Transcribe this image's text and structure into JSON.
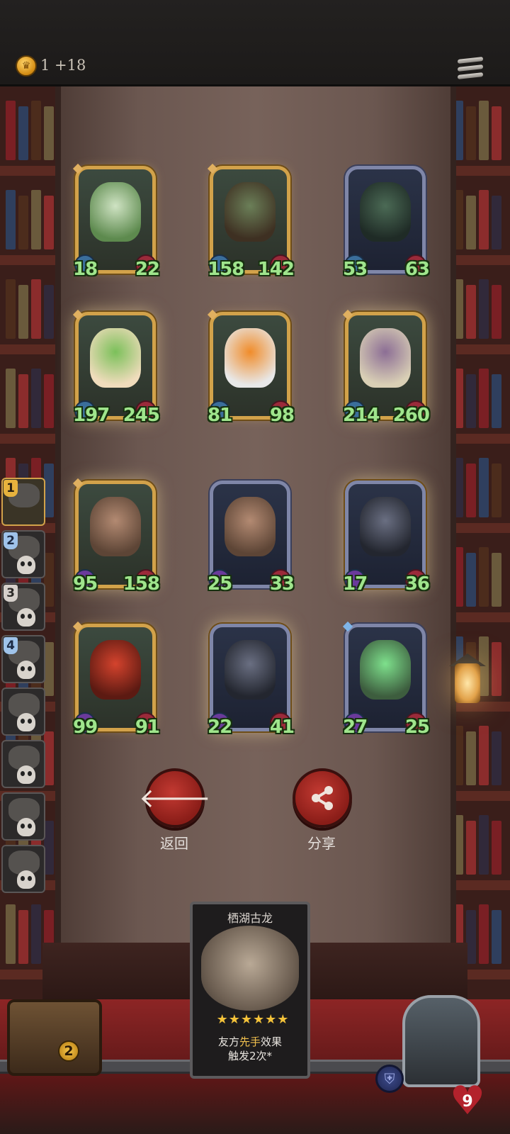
{
  "header": {
    "coin_text": "1 +18",
    "coin_icon": "crown-coin-icon",
    "menu_icon": "hamburger-menu-icon"
  },
  "cards": [
    {
      "name": "mandrake",
      "atk": "18",
      "hp": "22",
      "frame": "gold",
      "palette": [
        "#cfe3c3",
        "#5d8a4e"
      ]
    },
    {
      "name": "mushroom-goblin",
      "atk": "158",
      "hp": "142",
      "frame": "gold",
      "palette": [
        "#6b7f58",
        "#3e3022"
      ]
    },
    {
      "name": "grinning-beast",
      "atk": "53",
      "hp": "63",
      "frame": "silver",
      "palette": [
        "#4b6a55",
        "#1f2b26"
      ]
    },
    {
      "name": "leaf-girl",
      "atk": "197",
      "hp": "245",
      "frame": "gold",
      "palette": [
        "#7bc05a",
        "#f0dcbc"
      ]
    },
    {
      "name": "pumpkin-ghost",
      "atk": "81",
      "hp": "98",
      "frame": "gold",
      "palette": [
        "#f08c2a",
        "#e8e8e8"
      ]
    },
    {
      "name": "mushroom-spider",
      "atk": "214",
      "hp": "260",
      "frame": "gold",
      "palette": [
        "#8c6e95",
        "#d9cfb5"
      ]
    },
    {
      "name": "tall-brute",
      "atk": "95",
      "hp": "158",
      "frame": "gold",
      "palette": [
        "#b38a72",
        "#5d4536"
      ]
    },
    {
      "name": "tall-brute",
      "atk": "25",
      "hp": "33",
      "frame": "silver",
      "palette": [
        "#b38a72",
        "#5d4536"
      ]
    },
    {
      "name": "shadow-dragon",
      "atk": "17",
      "hp": "36",
      "frame": "silver",
      "palette": [
        "#6a6f82",
        "#23262f"
      ]
    },
    {
      "name": "fire-dragon",
      "atk": "99",
      "hp": "91",
      "frame": "gold",
      "palette": [
        "#d4432d",
        "#5c1a12"
      ]
    },
    {
      "name": "shadow-dragon",
      "atk": "22",
      "hp": "41",
      "frame": "silver",
      "palette": [
        "#6a6f82",
        "#23262f"
      ]
    },
    {
      "name": "green-flame-sword",
      "atk": "27",
      "hp": "25",
      "frame": "silver",
      "palette": [
        "#7ee08c",
        "#3d5d3e"
      ]
    }
  ],
  "actions": {
    "back_label": "返回",
    "share_label": "分享",
    "back_icon": "arrow-left-icon",
    "share_icon": "share-icon"
  },
  "lineup": [
    {
      "num": "1",
      "style": "gold"
    },
    {
      "num": "2",
      "style": "blue"
    },
    {
      "num": "3",
      "style": "gray"
    },
    {
      "num": "4",
      "style": "blue"
    },
    {
      "num": "",
      "style": "none"
    },
    {
      "num": "",
      "style": "none"
    },
    {
      "num": "",
      "style": "none"
    },
    {
      "num": "",
      "style": "none"
    }
  ],
  "detail": {
    "title": "栖湖古龙",
    "stars": "★★★★★★",
    "star_count": 6,
    "text_line1_pre": "友方",
    "text_line1_hl": "先手",
    "text_line1_post": "效果",
    "text_line2": "触发2次*"
  },
  "status": {
    "chest_count": "2",
    "health": "9",
    "shield_icon": "shield-icon"
  },
  "colors": {
    "gold_frame": "#d2a24a",
    "silver_frame": "#7f86a8",
    "stat_green": "#9fe58c",
    "button_red": "#c33a32"
  }
}
